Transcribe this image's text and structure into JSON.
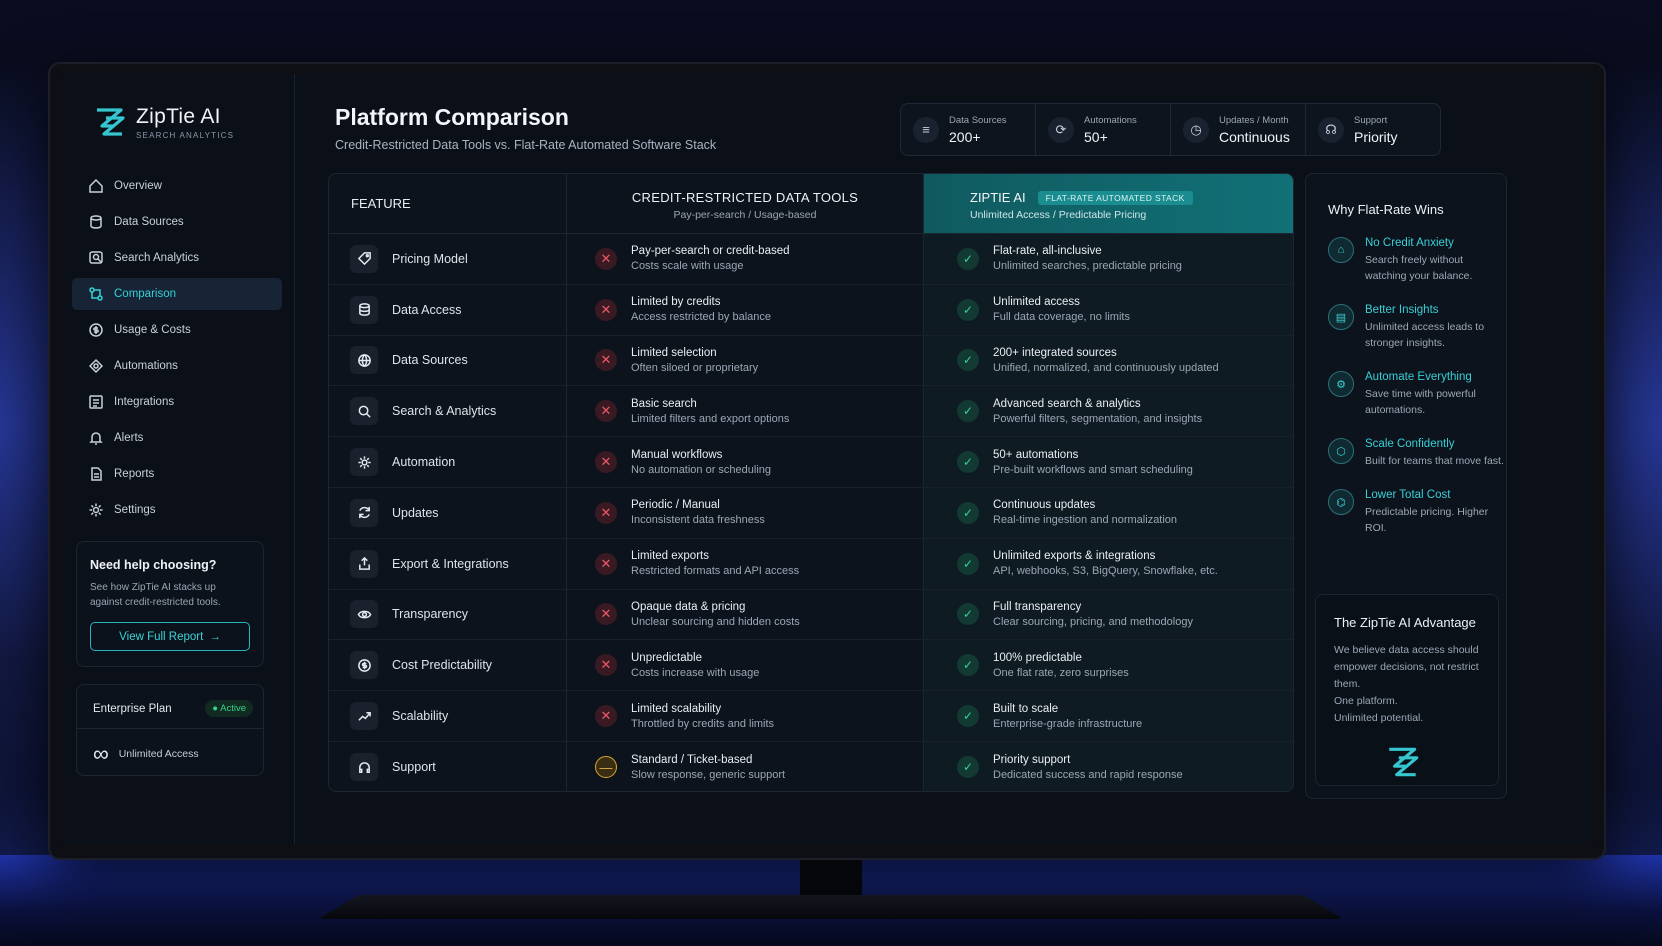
{
  "brand": {
    "name": "ZipTie AI",
    "sub": "SEARCH ANALYTICS"
  },
  "nav": [
    {
      "label": "Overview",
      "icon": "home-icon"
    },
    {
      "label": "Data Sources",
      "icon": "database-icon"
    },
    {
      "label": "Search Analytics",
      "icon": "search-icon"
    },
    {
      "label": "Comparison",
      "icon": "compare-icon",
      "active": true
    },
    {
      "label": "Usage & Costs",
      "icon": "dollar-icon"
    },
    {
      "label": "Automations",
      "icon": "automation-icon"
    },
    {
      "label": "Integrations",
      "icon": "integration-icon"
    },
    {
      "label": "Alerts",
      "icon": "bell-icon"
    },
    {
      "label": "Reports",
      "icon": "report-icon"
    },
    {
      "label": "Settings",
      "icon": "gear-icon"
    }
  ],
  "help": {
    "title": "Need help choosing?",
    "text": "See how ZipTie AI stacks up against credit-restricted tools.",
    "button": "View Full Report"
  },
  "plan": {
    "name": "Enterprise Plan",
    "status": "Active",
    "access": "Unlimited Access"
  },
  "header": {
    "title": "Platform Comparison",
    "subtitle": "Credit-Restricted Data Tools vs. Flat-Rate Automated Software Stack"
  },
  "stats": [
    {
      "label": "Data Sources",
      "value": "200+",
      "icon": "database-icon"
    },
    {
      "label": "Automations",
      "value": "50+",
      "icon": "refresh-icon"
    },
    {
      "label": "Updates / Month",
      "value": "Continuous",
      "icon": "clock-icon"
    },
    {
      "label": "Support",
      "value": "Priority",
      "icon": "headset-icon"
    }
  ],
  "table": {
    "feature_header": "FEATURE",
    "credit_header": "CREDIT-RESTRICTED DATA TOOLS",
    "credit_sub": "Pay-per-search / Usage-based",
    "zip_header": "ZIPTIE AI",
    "zip_tag": "FLAT-RATE AUTOMATED STACK",
    "zip_sub": "Unlimited Access / Predictable Pricing",
    "rows": [
      {
        "feature": "Pricing Model",
        "icon": "tag-icon",
        "credit1": "Pay-per-search or credit-based",
        "credit2": "Costs scale with usage",
        "credit_status": "x",
        "zip1": "Flat-rate, all-inclusive",
        "zip2": "Unlimited searches, predictable pricing"
      },
      {
        "feature": "Data Access",
        "icon": "database-icon",
        "credit1": "Limited by credits",
        "credit2": "Access restricted by balance",
        "credit_status": "x",
        "zip1": "Unlimited access",
        "zip2": "Full data coverage, no limits"
      },
      {
        "feature": "Data Sources",
        "icon": "globe-icon",
        "credit1": "Limited selection",
        "credit2": "Often siloed or proprietary",
        "credit_status": "x",
        "zip1": "200+ integrated sources",
        "zip2": "Unified, normalized, and continuously updated"
      },
      {
        "feature": "Search & Analytics",
        "icon": "search-icon",
        "credit1": "Basic search",
        "credit2": "Limited filters and export options",
        "credit_status": "x",
        "zip1": "Advanced search & analytics",
        "zip2": "Powerful filters, segmentation, and insights"
      },
      {
        "feature": "Automation",
        "icon": "gear-icon",
        "credit1": "Manual workflows",
        "credit2": "No automation or scheduling",
        "credit_status": "x",
        "zip1": "50+ automations",
        "zip2": "Pre-built workflows and smart scheduling"
      },
      {
        "feature": "Updates",
        "icon": "refresh-icon",
        "credit1": "Periodic / Manual",
        "credit2": "Inconsistent data freshness",
        "credit_status": "x",
        "zip1": "Continuous updates",
        "zip2": "Real-time ingestion and normalization"
      },
      {
        "feature": "Export & Integrations",
        "icon": "export-icon",
        "credit1": "Limited exports",
        "credit2": "Restricted formats and API access",
        "credit_status": "x",
        "zip1": "Unlimited exports & integrations",
        "zip2": "API, webhooks, S3, BigQuery, Snowflake, etc."
      },
      {
        "feature": "Transparency",
        "icon": "eye-icon",
        "credit1": "Opaque data & pricing",
        "credit2": "Unclear sourcing and hidden costs",
        "credit_status": "x",
        "zip1": "Full transparency",
        "zip2": "Clear sourcing, pricing, and methodology"
      },
      {
        "feature": "Cost Predictability",
        "icon": "dollar-icon",
        "credit1": "Unpredictable",
        "credit2": "Costs increase with usage",
        "credit_status": "x",
        "zip1": "100% predictable",
        "zip2": "One flat rate, zero surprises"
      },
      {
        "feature": "Scalability",
        "icon": "trend-icon",
        "credit1": "Limited scalability",
        "credit2": "Throttled by credits and limits",
        "credit_status": "x",
        "zip1": "Built to scale",
        "zip2": "Enterprise-grade infrastructure"
      },
      {
        "feature": "Support",
        "icon": "headset-icon",
        "credit1": "Standard / Ticket-based",
        "credit2": "Slow response, generic support",
        "credit_status": "partial",
        "zip1": "Priority support",
        "zip2": "Dedicated success and rapid response"
      }
    ]
  },
  "why": {
    "title": "Why Flat-Rate Wins",
    "items": [
      {
        "title": "No Credit Anxiety",
        "text": "Search freely without watching your balance."
      },
      {
        "title": "Better Insights",
        "text": "Unlimited access leads to stronger insights."
      },
      {
        "title": "Automate Everything",
        "text": "Save time with powerful automations."
      },
      {
        "title": "Scale Confidently",
        "text": "Built for teams that move fast."
      },
      {
        "title": "Lower Total Cost",
        "text": "Predictable pricing. Higher ROI."
      }
    ],
    "advantage_title": "The ZipTie AI Advantage",
    "advantage_text1": "We believe data access should empower decisions, not restrict them.",
    "advantage_text2": "One platform.",
    "advantage_text3": "Unlimited potential."
  },
  "colors": {
    "accent": "#35d1d6",
    "bad": "#ef5a6a",
    "good": "#37d0a4",
    "warn": "#e7b33d"
  }
}
